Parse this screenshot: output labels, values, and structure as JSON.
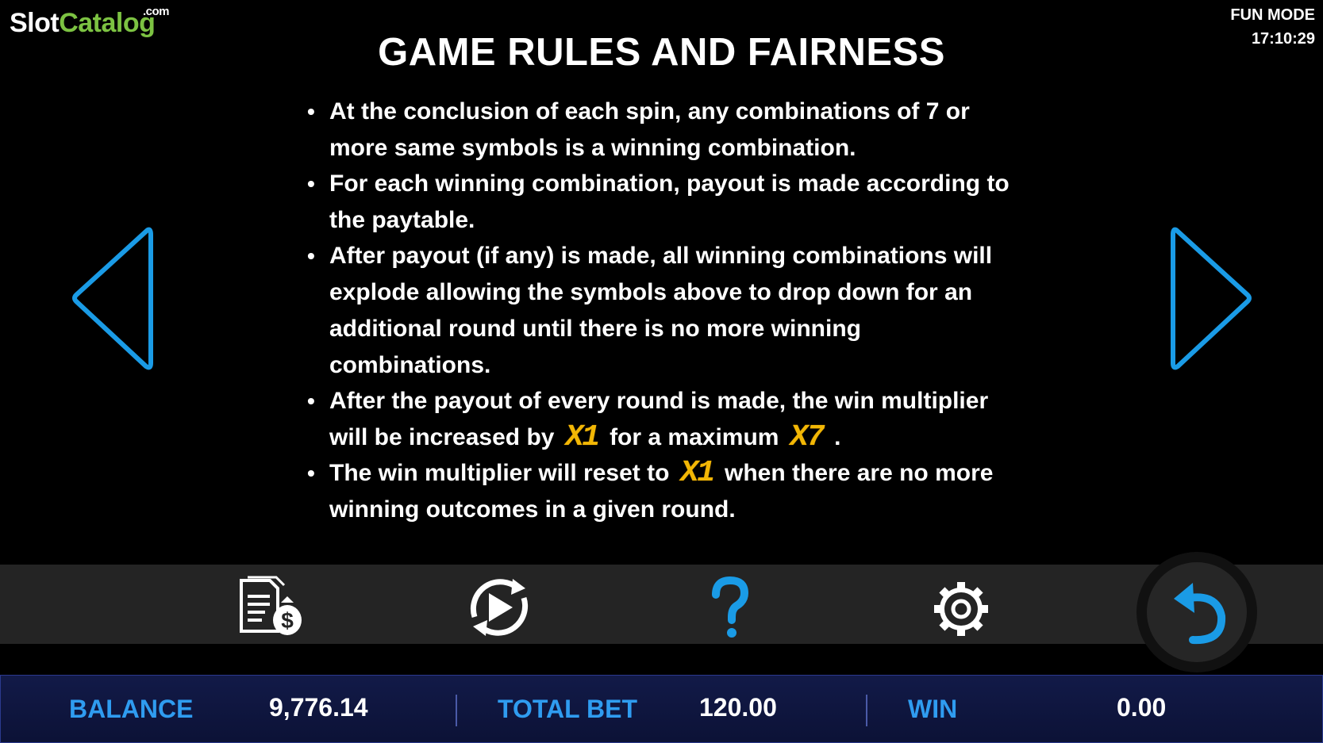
{
  "branding": {
    "logo_slot": "Slot",
    "logo_catalog": "Catalog",
    "logo_com": ".com"
  },
  "status": {
    "mode": "FUN MODE",
    "time": "17:10:29"
  },
  "page": {
    "title": "GAME RULES AND FAIRNESS"
  },
  "rules": {
    "r1": "At the conclusion of each spin, any combinations of 7 or more same symbols is a winning combination.",
    "r2": "For each winning combination, payout is made according to the paytable.",
    "r3": "After payout (if any) is made, all winning combinations will explode allowing the symbols above to drop down for an additional round until there is no more winning combinations.",
    "r4_a": "After the payout of every round is made, the win multiplier will be increased by",
    "r4_m1": "X1",
    "r4_b": "for a maximum",
    "r4_m2": "X7",
    "r4_c": ".",
    "r5_a": "The win multiplier will reset to",
    "r5_m1": "X1",
    "r5_b": "when there are no more winning outcomes in a given round."
  },
  "toolbar": {
    "icons": [
      "paytable-icon",
      "autoplay-icon",
      "help-icon",
      "settings-icon",
      "back-icon"
    ]
  },
  "footer": {
    "balance_label": "BALANCE",
    "balance_value": "9,776.14",
    "bet_label": "TOTAL BET",
    "bet_value": "120.00",
    "win_label": "WIN",
    "win_value": "0.00"
  },
  "colors": {
    "accent": "#2f9cf0",
    "multiplier": "#f2b705",
    "logo_green": "#7cc242",
    "panel": "#242424",
    "footer": "#121a48"
  }
}
